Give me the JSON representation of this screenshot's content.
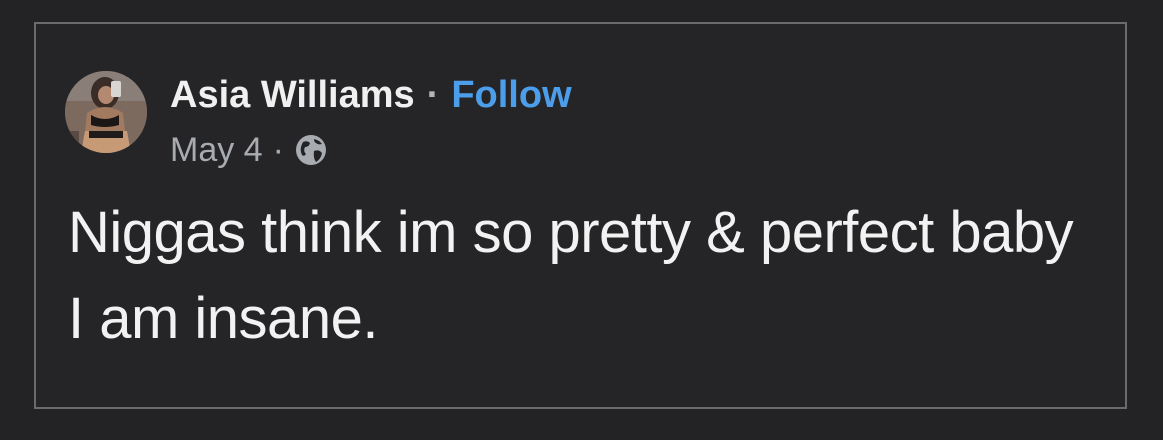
{
  "post": {
    "author": "Asia Williams",
    "separator": "·",
    "follow_label": "Follow",
    "date": "May 4",
    "meta_separator": "·",
    "audience_icon": "globe-icon",
    "text": "Niggas think im so pretty & perfect baby I am insane."
  },
  "colors": {
    "background": "#232325",
    "border": "#6b6b6e",
    "text": "#f2f2f2",
    "meta": "#a8abb0",
    "link": "#4d9eea"
  }
}
